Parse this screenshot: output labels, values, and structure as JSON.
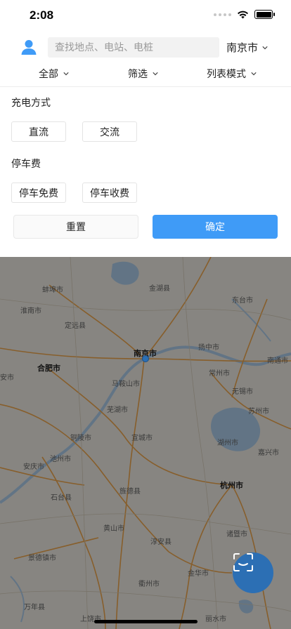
{
  "status_bar": {
    "time": "2:08"
  },
  "header": {
    "search_placeholder": "查找地点、电站、电桩",
    "city": "南京市"
  },
  "filter_tabs": [
    {
      "label": "全部"
    },
    {
      "label": "筛选"
    },
    {
      "label": "列表模式"
    }
  ],
  "filter_panel": {
    "charging_method": {
      "title": "充电方式",
      "options": [
        "直流",
        "交流"
      ]
    },
    "parking_fee": {
      "title": "停车费",
      "options": [
        "停车免费",
        "停车收费"
      ]
    },
    "reset_label": "重置",
    "confirm_label": "确定"
  },
  "map": {
    "labels": [
      "金湖县",
      "蚌埠市",
      "东台市",
      "淮南市",
      "定远县",
      "扬中市",
      "南京市",
      "合肥市",
      "常州市",
      "南通市",
      "马鞍山市",
      "无锡市",
      "芜湖市",
      "苏州市",
      "铜陵市",
      "宣城市",
      "湖州市",
      "池州市",
      "嘉兴市",
      "安庆市",
      "杭州市",
      "石台县",
      "旌德县",
      "黄山市",
      "诸暨市",
      "淳安县",
      "景德镇市",
      "金华市",
      "衢州市",
      "万年县",
      "上饶市",
      "丽水市",
      "安市"
    ]
  },
  "colors": {
    "accent": "#3f9bf7",
    "scan_button": "#2c6fb4",
    "map_overlay": "rgba(0,0,0,0.42)"
  },
  "icons": {
    "avatar": "user-icon",
    "scan": "scan-icon"
  }
}
